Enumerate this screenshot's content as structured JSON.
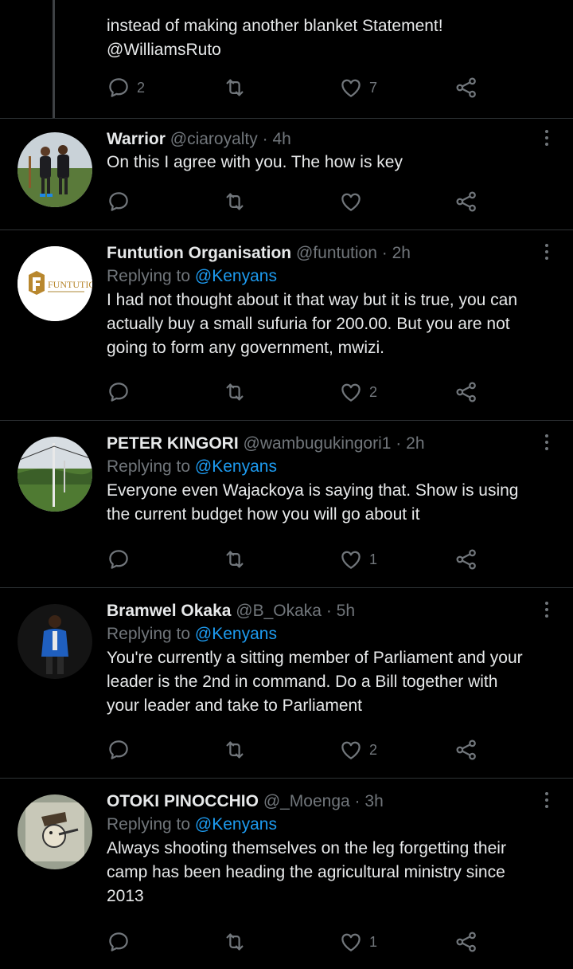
{
  "top_tweet": {
    "text_line": "instead of making another blanket Statement!",
    "mention": "@WilliamsRuto",
    "reply_count": "2",
    "retweet_count": "",
    "like_count": "7"
  },
  "tweets": [
    {
      "name": "Warrior",
      "handle": "@ciaroyalty",
      "dot": "·",
      "time": "4h",
      "replying_label": "",
      "replying_to": "",
      "lines": [
        "On this I agree with you. The how is key"
      ],
      "reply_count": "",
      "retweet_count": "",
      "like_count": ""
    },
    {
      "name": "Funtution Organisation",
      "handle": "@funtution",
      "dot": "·",
      "time": "2h",
      "replying_label": "Replying to",
      "replying_to": "@Kenyans",
      "lines": [
        "I had not thought about it that way but it is true, you can",
        "actually buy a small sufuria for 200.00. But you are not",
        "going to form any government, mwizi."
      ],
      "reply_count": "",
      "retweet_count": "",
      "like_count": "2",
      "avatar_text": "FUNTUTION"
    },
    {
      "name": "PETER KINGORI",
      "handle": "@wambugukingori1",
      "dot": "·",
      "time": "2h",
      "replying_label": "Replying to",
      "replying_to": "@Kenyans",
      "lines": [
        "Everyone even Wajackoya is saying that.  Show is using",
        "the current budget how you will go about it"
      ],
      "reply_count": "",
      "retweet_count": "",
      "like_count": "1"
    },
    {
      "name": "Bramwel Okaka",
      "handle": "@B_Okaka",
      "dot": "·",
      "time": "5h",
      "replying_label": "Replying to",
      "replying_to": "@Kenyans",
      "lines": [
        "You're currently a sitting member of Parliament and your",
        "leader is the 2nd in command. Do a Bill together with",
        "your leader and take to Parliament"
      ],
      "reply_count": "",
      "retweet_count": "",
      "like_count": "2"
    },
    {
      "name": "OTOKI PINOCCHIO",
      "handle": "@_Moenga",
      "dot": "·",
      "time": "3h",
      "replying_label": "Replying to",
      "replying_to": "@Kenyans",
      "lines": [
        "Always shooting themselves on the leg forgetting their",
        "camp has been heading the agricultural ministry since",
        "2013"
      ],
      "reply_count": "",
      "retweet_count": "",
      "like_count": "1"
    }
  ],
  "icons": {
    "reply": "reply-icon",
    "retweet": "retweet-icon",
    "like": "like-icon",
    "share": "share-icon",
    "more": "more-icon"
  },
  "colors": {
    "background": "#000000",
    "text": "#e7e9ea",
    "muted": "#71767b",
    "accent": "#1d9bf0",
    "divider": "#2f3336"
  }
}
